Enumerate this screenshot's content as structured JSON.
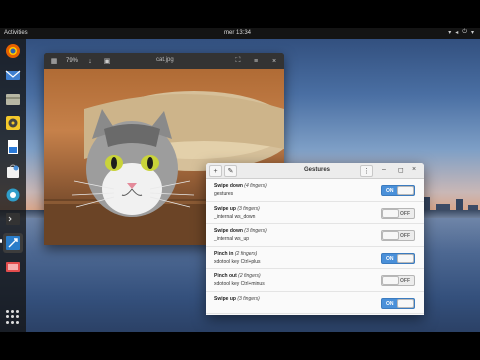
{
  "top_panel": {
    "activities_label": "Activities",
    "clock": "mer 13:34"
  },
  "dock": {
    "items": [
      "firefox-icon",
      "thunderbird-icon",
      "files-icon",
      "rhythmbox-icon",
      "document-icon",
      "software-icon",
      "help-icon",
      "terminal-icon",
      "gestures-icon",
      "appcenter-icon"
    ],
    "show_apps_icon": "grid-icon"
  },
  "viewer": {
    "title": "cat.jpg",
    "zoom": "79%"
  },
  "gestures_window": {
    "title": "Gestures",
    "rows": [
      {
        "name": "Swipe down",
        "fingers": "(4 fingers)",
        "command": "gestures",
        "state": "ON",
        "on": true
      },
      {
        "name": "Swipe up",
        "fingers": "(3 fingers)",
        "command": "_internal ws_down",
        "state": "OFF",
        "on": false
      },
      {
        "name": "Swipe down",
        "fingers": "(3 fingers)",
        "command": "_internal ws_up",
        "state": "OFF",
        "on": false
      },
      {
        "name": "Pinch in",
        "fingers": "(2 fingers)",
        "command": "xdotool key Ctrl+plus",
        "state": "ON",
        "on": true
      },
      {
        "name": "Pinch out",
        "fingers": "(2 fingers)",
        "command": "xdotool key Ctrl+minus",
        "state": "OFF",
        "on": false
      },
      {
        "name": "Swipe up",
        "fingers": "(3 fingers)",
        "command": "",
        "state": "ON",
        "on": true
      }
    ]
  },
  "colors": {
    "switch_on": "#4a90d9",
    "panel": "#141414"
  }
}
